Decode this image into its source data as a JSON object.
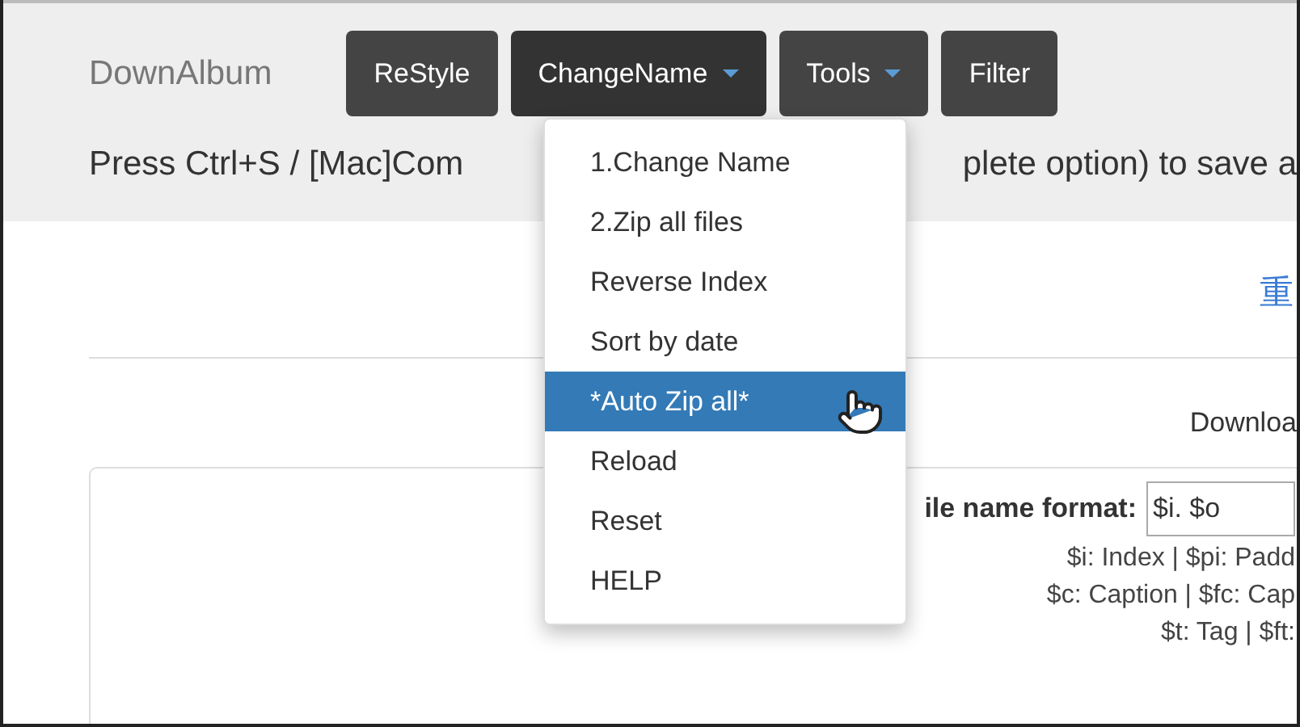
{
  "brand": "DownAlbum",
  "buttons": [
    {
      "label": "ReStyle",
      "dropdown": false,
      "expanded": false
    },
    {
      "label": "ChangeName",
      "dropdown": true,
      "expanded": true
    },
    {
      "label": "Tools",
      "dropdown": true,
      "expanded": false
    },
    {
      "label": "Filter",
      "dropdown": false,
      "expanded": false
    }
  ],
  "notice": {
    "left": "Press Ctrl+S / [Mac]Com",
    "right": "plete option) to save a"
  },
  "menu": {
    "items": [
      {
        "label": "1.Change Name",
        "selected": false
      },
      {
        "label": "2.Zip all files",
        "selected": false
      },
      {
        "label": "Reverse Index",
        "selected": false
      },
      {
        "label": "Sort by date",
        "selected": false
      },
      {
        "label": "*Auto Zip all*",
        "selected": true
      },
      {
        "label": "Reload",
        "selected": false
      },
      {
        "label": "Reset",
        "selected": false
      },
      {
        "label": "HELP",
        "selected": false
      }
    ]
  },
  "corner_glyph": "重",
  "download_label": "Downloa",
  "format": {
    "label": "ile name format:",
    "value": "$i. $o"
  },
  "help_lines": [
    "$i: Index | $pi: Padd",
    "$c: Caption | $fc: Cap",
    "$t: Tag | $ft:"
  ]
}
